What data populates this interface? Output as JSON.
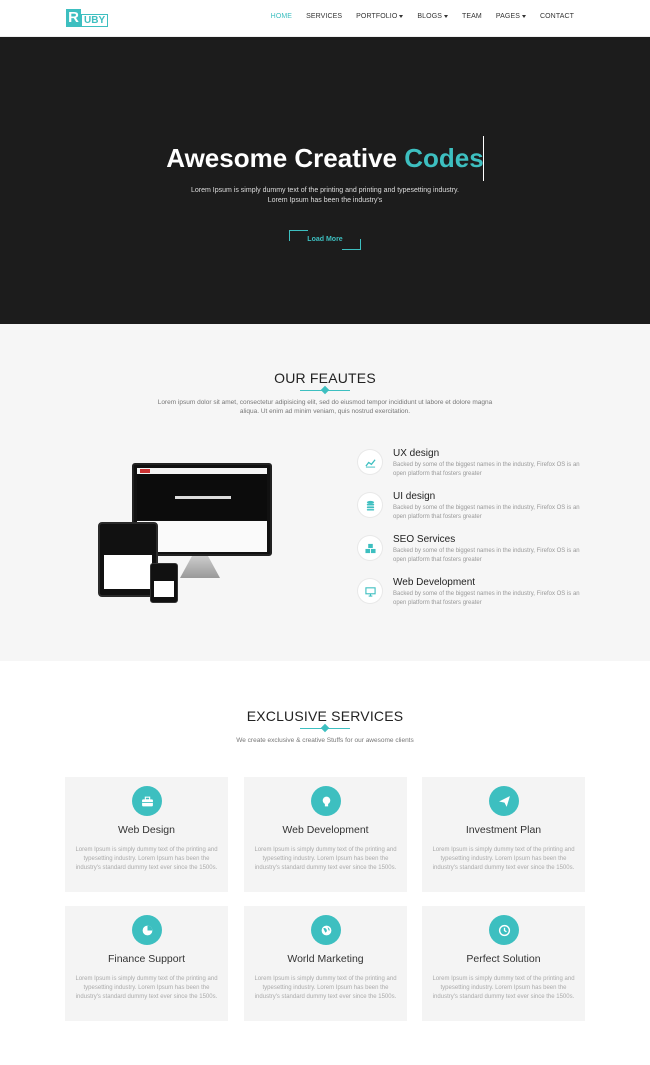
{
  "brand": {
    "logo_letter": "R",
    "logo_rest": "UBY"
  },
  "nav": {
    "items": [
      {
        "label": "HOME",
        "active": true,
        "dropdown": false
      },
      {
        "label": "SERVICES",
        "active": false,
        "dropdown": false
      },
      {
        "label": "PORTFOLIO",
        "active": false,
        "dropdown": true
      },
      {
        "label": "BLOGS",
        "active": false,
        "dropdown": true
      },
      {
        "label": "TEAM",
        "active": false,
        "dropdown": false
      },
      {
        "label": "PAGES",
        "active": false,
        "dropdown": true
      },
      {
        "label": "CONTACT",
        "active": false,
        "dropdown": false
      }
    ]
  },
  "hero": {
    "title_main": "Awesome Creative ",
    "title_highlight": "Codes",
    "subtitle_line1": "Lorem Ipsum is simply dummy text of the printing and printing and typesetting industry.",
    "subtitle_line2": "Lorem Ipsum has been the industry's",
    "button_label": "Load More"
  },
  "features": {
    "title": "OUR FEAUTES",
    "description": "Lorem ipsum dolor sit amet, consectetur adipisicing elit, sed do eiusmod tempor incididunt ut labore et dolore magna aliqua. Ut enim ad minim veniam, quis nostrud exercitation.",
    "items": [
      {
        "title": "UX design",
        "icon": "line-chart-icon",
        "desc": "Backed by some of the biggest names in the industry, Firefox OS is an open platform that fosters greater"
      },
      {
        "title": "UI design",
        "icon": "database-icon",
        "desc": "Backed by some of the biggest names in the industry, Firefox OS is an open platform that fosters greater"
      },
      {
        "title": "SEO Services",
        "icon": "cubes-icon",
        "desc": "Backed by some of the biggest names in the industry, Firefox OS is an open platform that fosters greater"
      },
      {
        "title": "Web Development",
        "icon": "monitor-icon",
        "desc": "Backed by some of the biggest names in the industry, Firefox OS is an open platform that fosters greater"
      }
    ]
  },
  "services": {
    "title": "EXCLUSIVE SERVICES",
    "description": "We create exclusive & creative Stuffs for our awesome clients",
    "items": [
      {
        "title": "Web Design",
        "icon": "briefcase-icon",
        "desc": "Lorem Ipsum is simply dummy text of the printing and typesetting industry. Lorem Ipsum has been the industry's standard dummy text ever since the 1500s."
      },
      {
        "title": "Web Development",
        "icon": "lightbulb-icon",
        "desc": "Lorem Ipsum is simply dummy text of the printing and typesetting industry. Lorem Ipsum has been the industry's standard dummy text ever since the 1500s."
      },
      {
        "title": "Investment Plan",
        "icon": "paper-plane-icon",
        "desc": "Lorem Ipsum is simply dummy text of the printing and typesetting industry. Lorem Ipsum has been the industry's standard dummy text ever since the 1500s."
      },
      {
        "title": "Finance Support",
        "icon": "pie-chart-icon",
        "desc": "Lorem Ipsum is simply dummy text of the printing and typesetting industry. Lorem Ipsum has been the industry's standard dummy text ever since the 1500s."
      },
      {
        "title": "World Marketing",
        "icon": "globe-icon",
        "desc": "Lorem Ipsum is simply dummy text of the printing and typesetting industry. Lorem Ipsum has been the industry's standard dummy text ever since the 1500s."
      },
      {
        "title": "Perfect Solution",
        "icon": "clock-icon",
        "desc": "Lorem Ipsum is simply dummy text of the printing and typesetting industry. Lorem Ipsum has been the industry's standard dummy text ever since the 1500s."
      }
    ]
  },
  "colors": {
    "accent": "#3dbfc0",
    "hero_bg": "#1c1c1c",
    "features_bg": "#f6f6f6",
    "card_bg": "#f4f4f4"
  }
}
